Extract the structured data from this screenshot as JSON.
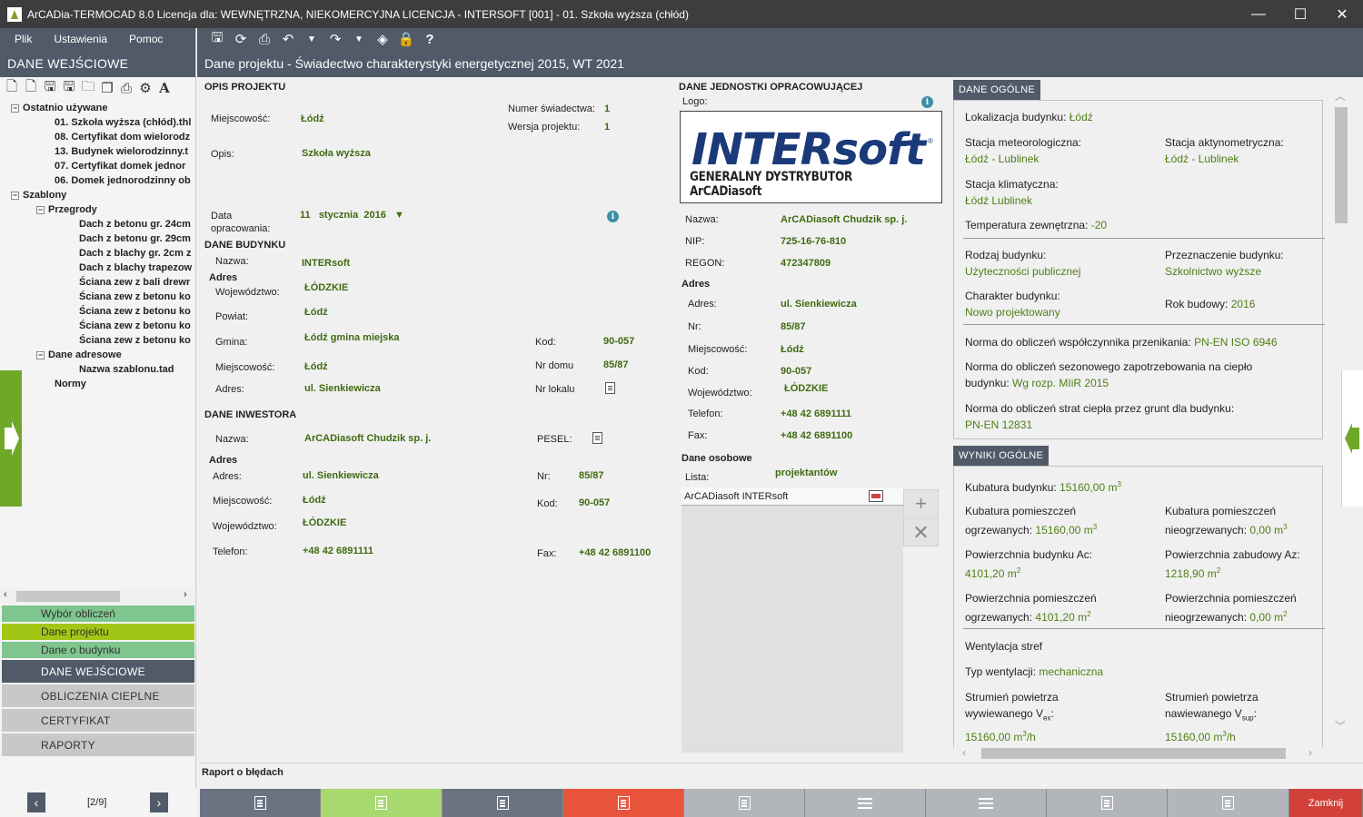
{
  "window": {
    "title": "ArCADia-TERMOCAD 8.0 Licencja dla: WEWNĘTRZNA, NIEKOMERCYJNA LICENCJA - INTERSOFT [001] - 01. Szkoła wyższa (chłód)",
    "minimize": "—",
    "maximize": "☐",
    "close": "✕"
  },
  "menu": {
    "items": [
      "Plik",
      "Ustawienia",
      "Pomoc"
    ]
  },
  "left": {
    "title": "DANE WEJŚCIOWE",
    "tree": {
      "recent_label": "Ostatnio używane",
      "recent": [
        "01. Szkoła wyższa (chłód).thl",
        "08. Certyfikat dom wielorodz",
        "13. Budynek wielorodzinny.t",
        "07. Certyfikat domek jednor",
        "06. Domek jednorodzinny ob"
      ],
      "templates_label": "Szablony",
      "partitions_label": "Przegrody",
      "partitions": [
        "Dach z betonu gr. 24cm",
        "Dach z betonu gr. 29cm",
        "Dach z blachy gr. 2cm z",
        "Dach z blachy trapezow",
        "Ściana zew z bali drewr",
        "Ściana zew z betonu ko",
        "Ściana zew z betonu ko",
        "Ściana zew z betonu ko",
        "Ściana zew z betonu ko"
      ],
      "address_label": "Dane adresowe",
      "address_item": "Nazwa szablonu.tad",
      "norms_label": "Normy"
    },
    "steps": [
      "Wybór obliczeń",
      "Dane projektu",
      "Dane o budynku"
    ],
    "sections": [
      "DANE WEJŚCIOWE",
      "OBLICZENIA CIEPLNE",
      "CERTYFIKAT",
      "RAPORTY"
    ],
    "pager": "[2/9]"
  },
  "page_title": "Dane projektu - Świadectwo charakterystyki energetycznej 2015, WT 2021",
  "project": {
    "section": "OPIS PROJEKTU",
    "city_label": "Miejscowość:",
    "city": "Łódź",
    "desc_label": "Opis:",
    "desc": "Szkoła wyższa",
    "cert_no_label": "Numer świadectwa:",
    "cert_no": "1",
    "version_label": "Wersja projektu:",
    "version": "1",
    "date_label": "Data opracowania:",
    "date_day": "11",
    "date_month": "stycznia",
    "date_year": "2016"
  },
  "building": {
    "section": "DANE BUDYNKU",
    "name_label": "Nazwa:",
    "name": "INTERsoft",
    "addr_label": "Adres",
    "voiv_label": "Województwo:",
    "voiv": "ŁÓDZKIE",
    "county_label": "Powiat:",
    "county": "Łódź",
    "commune_label": "Gmina:",
    "commune": "Łódź gmina miejska",
    "code_label": "Kod:",
    "code": "90-057",
    "city_label": "Miejscowość:",
    "city": "Łódź",
    "house_label": "Nr domu",
    "house": "85/87",
    "street_label": "Adres:",
    "street": "ul. Sienkiewicza",
    "flat_label": "Nr lokalu"
  },
  "investor": {
    "section": "DANE INWESTORA",
    "name_label": "Nazwa:",
    "name": "ArCADiasoft Chudzik sp. j.",
    "pesel_label": "PESEL:",
    "addr_label": "Adres",
    "street_label": "Adres:",
    "street": "ul. Sienkiewicza",
    "nr_label": "Nr:",
    "nr": "85/87",
    "city_label": "Miejscowość:",
    "city": "Łódź",
    "code_label": "Kod:",
    "code": "90-057",
    "voiv_label": "Województwo:",
    "voiv": "ŁÓDZKIE",
    "phone_label": "Telefon:",
    "phone": "+48 42 6891111",
    "fax_label": "Fax:",
    "fax": "+48 42 6891100"
  },
  "unit": {
    "section": "DANE JEDNOSTKI OPRACOWUJĄCEJ",
    "logo_label": "Logo:",
    "logo_big": "INTERsoft",
    "logo_reg": "®",
    "logo_sub": "GENERALNY DYSTRYBUTOR ArCADiasoft",
    "name_label": "Nazwa:",
    "name": "ArCADiasoft Chudzik sp. j.",
    "nip_label": "NIP:",
    "nip": "725-16-76-810",
    "regon_label": "REGON:",
    "regon": "472347809",
    "addr_label": "Adres",
    "street_label": "Adres:",
    "street": "ul. Sienkiewicza",
    "nr_label": "Nr:",
    "nr": "85/87",
    "city_label": "Miejscowość:",
    "city": "Łódź",
    "code_label": "Kod:",
    "code": "90-057",
    "voiv_label": "Województwo:",
    "voiv": "ŁÓDZKIE",
    "phone_label": "Telefon:",
    "phone": "+48 42 6891111",
    "fax_label": "Fax:",
    "fax": "+48 42 6891100",
    "persons_label": "Dane osobowe",
    "list_label": "Lista:",
    "list_value": "projektantów",
    "person": "ArCADiasoft INTERsoft"
  },
  "general": {
    "tab": "DANE OGÓLNE",
    "loc_label": "Lokalizacja budynku:",
    "loc": "Łódź",
    "met_label": "Stacja meteorologiczna:",
    "met": "Łódź - Lublinek",
    "act_label": "Stacja aktynometryczna:",
    "act": "Łódź - Lublinek",
    "clim_label": "Stacja klimatyczna:",
    "clim": "Łódź Lublinek",
    "temp_label": "Temperatura zewnętrzna:",
    "temp": "-20",
    "type_label": "Rodzaj budynku:",
    "type": "Użyteczności publicznej",
    "purpose_label": "Przeznaczenie budynku:",
    "purpose": "Szkolnictwo wyższe",
    "char_label": "Charakter budynku:",
    "char": "Nowo projektowany",
    "year_label": "Rok budowy:",
    "year": "2016",
    "norm1_label": "Norma do obliczeń współczynnika przenikania:",
    "norm1": "PN-EN ISO 6946",
    "norm2_label_a": "Norma do obliczeń sezonowego zapotrzebowania na ciepło",
    "norm2_label_b": "budynku:",
    "norm2": "Wg rozp. MIiR 2015",
    "norm3_label": "Norma do obliczeń strat ciepła przez grunt dla budynku:",
    "norm3": "PN-EN 12831"
  },
  "results": {
    "tab": "WYNIKI OGÓLNE",
    "vol_label": "Kubatura budynku:",
    "vol": "15160,00 m",
    "vol_exp": "3",
    "vol_h_label_a": "Kubatura pomieszczeń",
    "vol_h_label_b": "ogrzewanych:",
    "vol_h": "15160,00 m",
    "vol_h_exp": "3",
    "vol_nh_label_a": "Kubatura pomieszczeń",
    "vol_nh_label_b": "nieogrzewanych:",
    "vol_nh": "0,00 m",
    "vol_nh_exp": "3",
    "ac_label": "Powierzchnia budynku Ac:",
    "ac": "4101,20 m",
    "ac_exp": "2",
    "az_label": "Powierzchnia zabudowy Az:",
    "az": "1218,90 m",
    "az_exp": "2",
    "ah_label_a": "Powierzchnia pomieszczeń",
    "ah_label_b": "ogrzewanych:",
    "ah": "4101,20 m",
    "ah_exp": "2",
    "anh_label_a": "Powierzchnia pomieszczeń",
    "anh_label_b": "nieogrzewanych:",
    "anh": "0,00 m",
    "anh_exp": "2",
    "vent_label": "Wentylacja stref",
    "venttype_label": "Typ wentylacji:",
    "venttype": "mechaniczna",
    "vex_label_a": "Strumień powietrza",
    "vex_label_b": "wywiewanego V",
    "vex_sub": "ex",
    "vex": "15160,00 m",
    "vex_exp": "3",
    "vex_unit": "/h",
    "vsup_label_a": "Strumień powietrza",
    "vsup_label_b": "nawiewanego V",
    "vsup_sub": "sup",
    "vsup": "15160,00 m",
    "vsup_exp": "3",
    "vsup_unit": "/h",
    "colon": ":"
  },
  "error_report": "Raport o błędach",
  "bottom": {
    "close_label": "Zamknij"
  },
  "colors": {
    "accent_dark": "#505a68",
    "green": "#6fa829",
    "lime": "#a2c616",
    "step_green": "#7ec58e",
    "red": "#e8553c",
    "close_red": "#d2403a",
    "value_green": "#3f6b11"
  }
}
